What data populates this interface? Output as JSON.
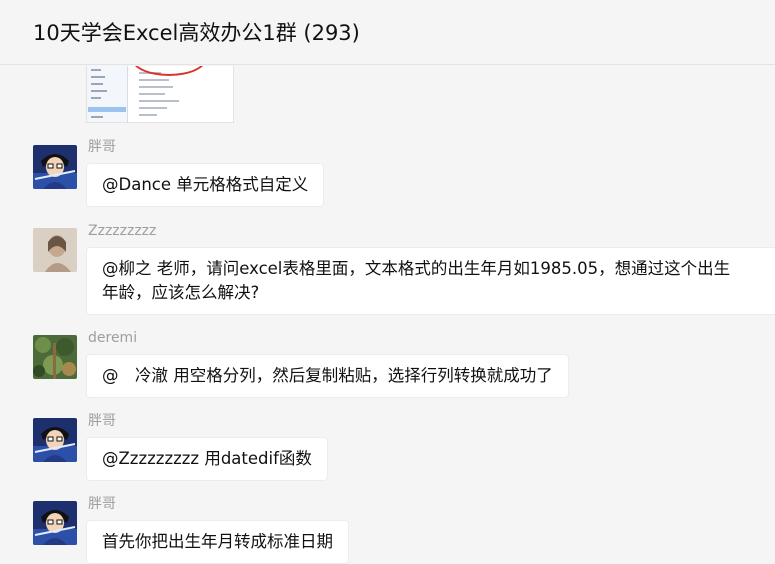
{
  "header": {
    "title": "10天学会Excel高效办公1群 (293)"
  },
  "messages": [
    {
      "sender": "胖哥",
      "avatar": "anime-boy-avatar",
      "text": "@Dance 单元格格式自定义"
    },
    {
      "sender": "Zzzzzzzzz",
      "avatar": "portrait-photo-avatar",
      "text_line1": "@柳之 老师，请问excel表格里面，文本格式的出生年月如1985.05，想通过这个出生",
      "text_line2": "年龄，应该怎么解决?"
    },
    {
      "sender": "deremi",
      "avatar": "plant-photo-avatar",
      "text": "@　冷澈 用空格分列，然后复制粘贴，选择行列转换就成功了"
    },
    {
      "sender": "胖哥",
      "avatar": "anime-boy-avatar",
      "text": "@Zzzzzzzzz 用datedif函数"
    },
    {
      "sender": "胖哥",
      "avatar": "anime-boy-avatar",
      "text": "首先你把出生年月转成标准日期"
    }
  ]
}
